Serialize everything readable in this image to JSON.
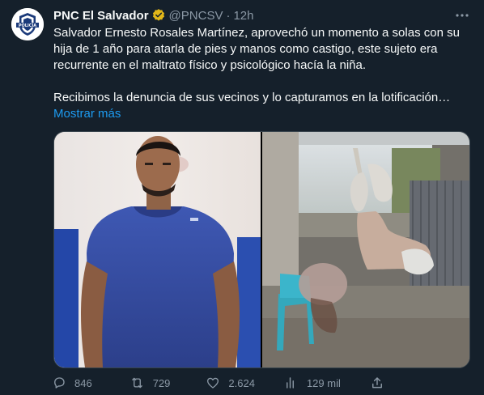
{
  "account": {
    "display_name": "PNC El Salvador",
    "handle": "@PNCSV",
    "separator": "·",
    "time": "12h",
    "avatar_text": "POLICÍA"
  },
  "tweet": {
    "paragraph1": "Salvador Ernesto Rosales Martínez, aprovechó un momento a solas con su hija de 1 año para atarla de pies y manos como castigo, este sujeto era recurrente en el maltrato físico y psicológico hacía la niña.",
    "paragraph2": "Recibimos la denuncia de sus vecinos y lo capturamos en la lotificación…",
    "show_more": "Mostrar más"
  },
  "actions": {
    "replies": "846",
    "retweets": "729",
    "likes": "2.624",
    "views": "129 mil"
  },
  "icons": {
    "verified": "verified-badge-icon",
    "more": "more-options-icon",
    "reply": "reply-icon",
    "retweet": "retweet-icon",
    "like": "heart-icon",
    "views": "views-chart-icon",
    "share": "share-icon"
  },
  "colors": {
    "background": "#15202b",
    "text": "#f7f9f9",
    "secondary": "#8b98a5",
    "accent": "#1d9bf0",
    "border": "#38444d"
  }
}
